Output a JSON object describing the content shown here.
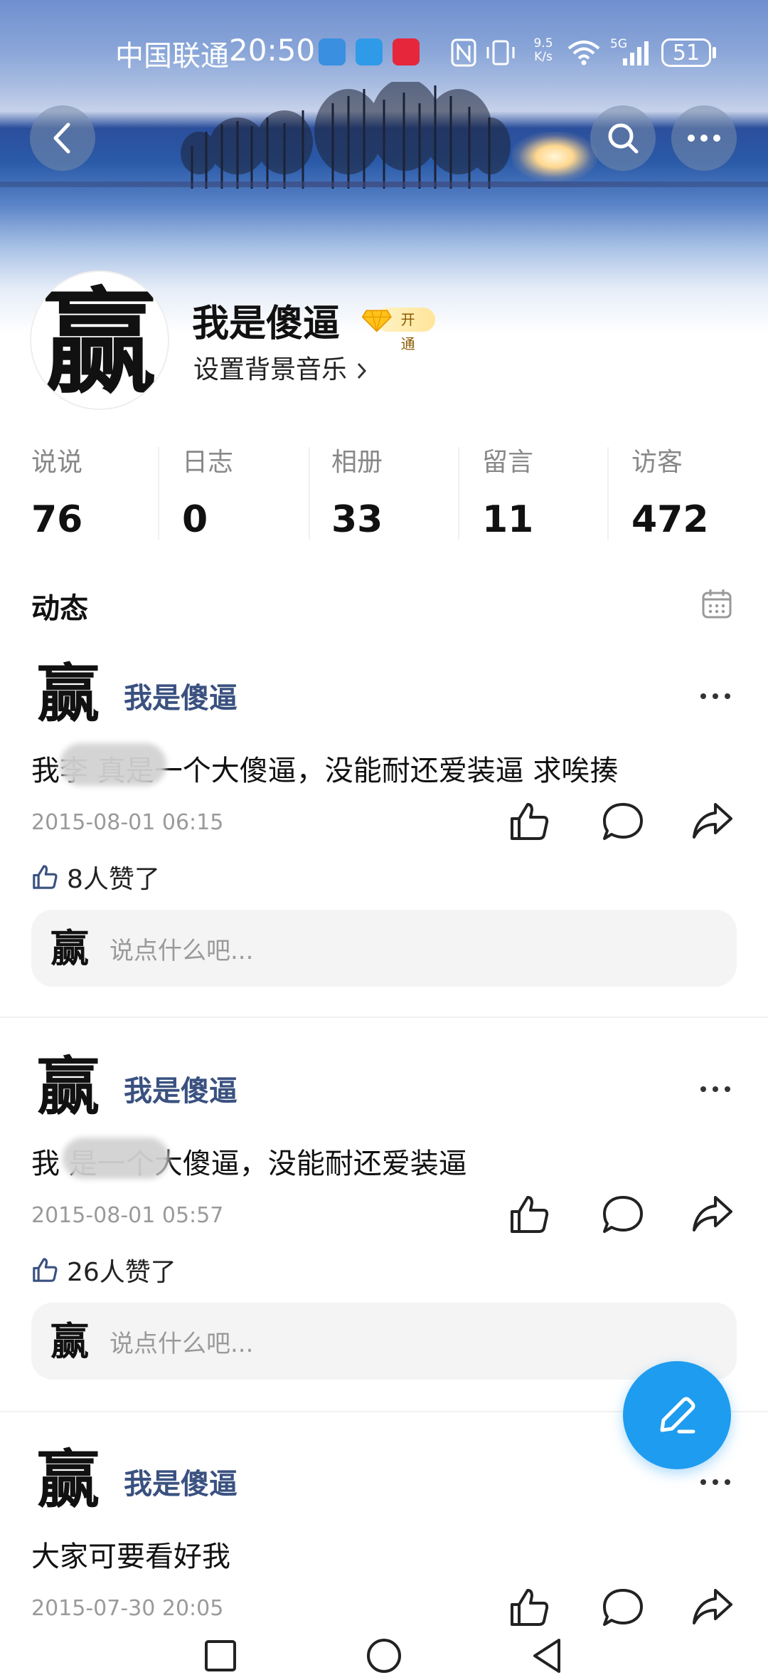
{
  "status_bar": {
    "carrier": "中国联通",
    "time": "20:50",
    "net_speed_value": "9.5",
    "net_speed_unit": "K/s",
    "network": "5G",
    "battery": "51"
  },
  "profile": {
    "avatar_char": "赢",
    "name": "我是傻逼",
    "vip_label": "开通",
    "bg_music": "设置背景音乐"
  },
  "stats": [
    {
      "label": "说说",
      "value": "76"
    },
    {
      "label": "日志",
      "value": "0"
    },
    {
      "label": "相册",
      "value": "33"
    },
    {
      "label": "留言",
      "value": "11"
    },
    {
      "label": "访客",
      "value": "472"
    }
  ],
  "feed": {
    "title": "动态",
    "comment_placeholder": "说点什么吧...",
    "posts": [
      {
        "author": "我是傻逼",
        "text": "我李      真是一个大傻逼，没能耐还爱装逼  求唉揍",
        "time": "2015-08-01 06:15",
        "likes": "8人赞了"
      },
      {
        "author": "我是傻逼",
        "text": "我         是一个大傻逼，没能耐还爱装逼",
        "time": "2015-08-01 05:57",
        "likes": "26人赞了"
      },
      {
        "author": "我是傻逼",
        "text": "大家可要看好我",
        "time": "2015-07-30 20:05"
      }
    ]
  },
  "colors": {
    "accent": "#1e9cf0",
    "author_name": "#3a5180",
    "muted_text": "#9a9a9a"
  },
  "icons": [
    "back-arrow-icon",
    "search-icon",
    "more-icon",
    "calendar-icon",
    "thumbs-up-icon",
    "comment-icon",
    "share-icon",
    "edit-pencil-icon",
    "recent-apps-icon",
    "home-icon",
    "back-icon"
  ]
}
